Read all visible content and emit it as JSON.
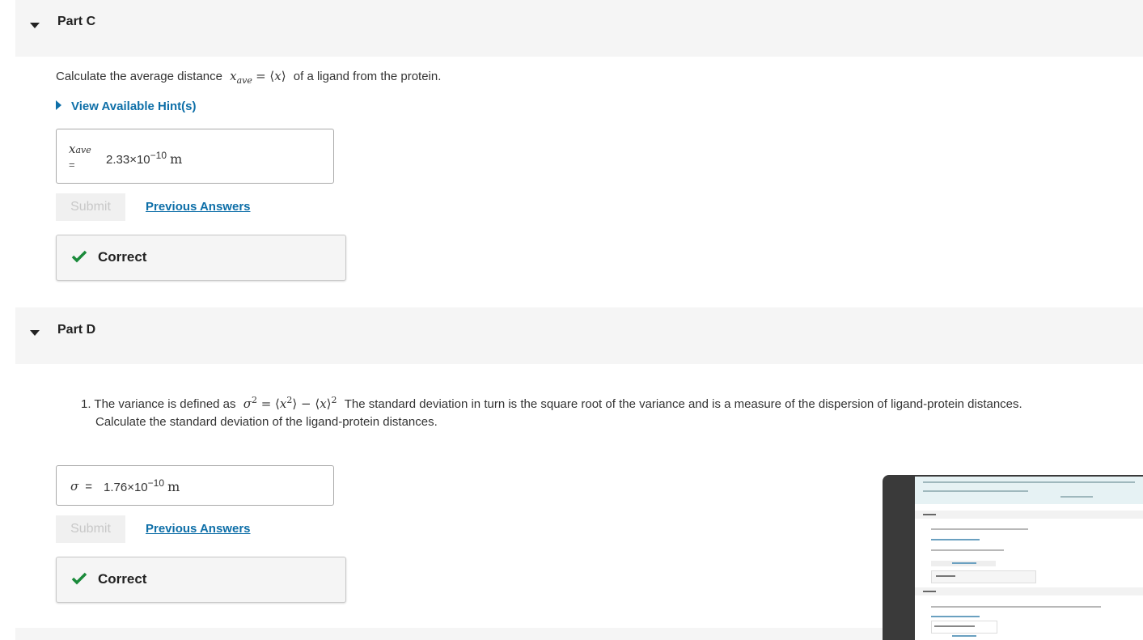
{
  "colors": {
    "accent": "#0e6fa8",
    "correct": "#1a8a3a",
    "header_bg": "#f5f5f5"
  },
  "part_c": {
    "title": "Part C",
    "question_before": "Calculate the average distance",
    "question_math": "x_ave = ⟨x⟩",
    "question_after": "of a ligand from the protein.",
    "hint_link": "View Available Hint(s)",
    "answer_label": "x_ave =",
    "answer_mantissa": "2.33×10",
    "answer_exponent": "−10",
    "answer_unit": "m",
    "submit_label": "Submit",
    "previous_answers": "Previous Answers",
    "feedback": "Correct"
  },
  "part_d": {
    "title": "Part D",
    "question_number": "1.",
    "question_before": "The variance is defined as",
    "question_math": "σ² = ⟨x²⟩ − ⟨x⟩²",
    "question_after": "The standard deviation in turn is the square root of the variance and is a measure of the dispersion of ligand-protein distances.",
    "question_line2": "Calculate the standard deviation of the ligand-protein distances.",
    "answer_label": "σ =",
    "answer_mantissa": "1.76×10",
    "answer_exponent": "−10",
    "answer_unit": "m",
    "submit_label": "Submit",
    "previous_answers": "Previous Answers",
    "feedback": "Correct"
  }
}
